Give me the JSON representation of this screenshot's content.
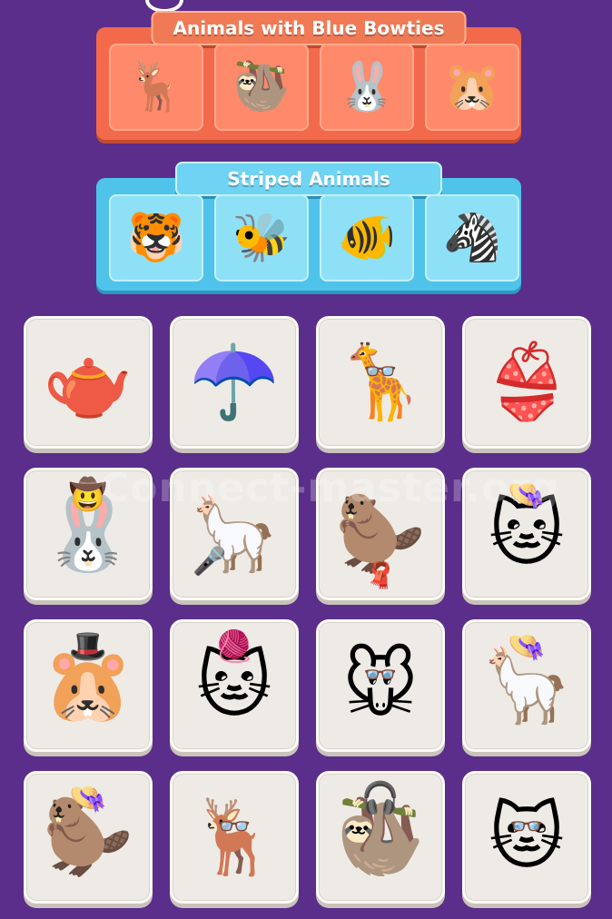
{
  "groups": [
    {
      "title": "Animals with Blue Bowties",
      "slots": [
        {
          "icon": "deer-with-blue-bowtie",
          "glyph": "🦌"
        },
        {
          "icon": "sloth-with-blue-bowtie",
          "glyph": "🦥"
        },
        {
          "icon": "rabbit-with-hat-and-blue-bowtie",
          "glyph": "🐰"
        },
        {
          "icon": "hamster-with-blue-bowtie",
          "glyph": "🐹"
        }
      ]
    },
    {
      "title": "Striped Animals",
      "slots": [
        {
          "icon": "tiger",
          "glyph": "🐯"
        },
        {
          "icon": "bee",
          "glyph": "🐝"
        },
        {
          "icon": "striped-fish",
          "glyph": "🐠"
        },
        {
          "icon": "zebra",
          "glyph": "🦓"
        }
      ]
    }
  ],
  "tiles": [
    {
      "icon": "polka-dot-teapot",
      "glyph": "🫖"
    },
    {
      "icon": "polka-dot-umbrella",
      "glyph": "☂️"
    },
    {
      "icon": "giraffe-with-red-glasses",
      "glyph": "🦒",
      "acc": "👓",
      "acc_pos": "glasses"
    },
    {
      "icon": "polka-dot-bikini",
      "glyph": "👙"
    },
    {
      "icon": "rabbit-with-red-cowboy-hat",
      "glyph": "🐰",
      "acc": "🤠",
      "acc_pos": "hat"
    },
    {
      "icon": "llama-singer-with-microphone",
      "glyph": "🦙",
      "acc": "🎤",
      "acc_pos": "mic"
    },
    {
      "icon": "beaver-with-flower-crown-and-scarf",
      "glyph": "🦫",
      "acc": "🧣",
      "acc_pos": "neck"
    },
    {
      "icon": "cat-with-pink-hat",
      "glyph": "🐱",
      "acc": "👒",
      "acc_pos": "hat"
    },
    {
      "icon": "hamster-with-pink-top-hat",
      "glyph": "🐹",
      "acc": "🎩",
      "acc_pos": "hat"
    },
    {
      "icon": "cat-with-beanie-and-scarf",
      "glyph": "🐱",
      "acc": "🧶",
      "acc_pos": "hat"
    },
    {
      "icon": "mouse-with-red-glasses",
      "glyph": "🐭",
      "acc": "👓",
      "acc_pos": "glasses"
    },
    {
      "icon": "llama-with-pink-hat",
      "glyph": "🦙",
      "acc": "👒",
      "acc_pos": "hat"
    },
    {
      "icon": "meerkat-with-red-hat",
      "glyph": "🦫",
      "acc": "👒",
      "acc_pos": "hat"
    },
    {
      "icon": "deer-with-red-glasses-and-bowtie",
      "glyph": "🦌",
      "acc": "👓",
      "acc_pos": "glasses"
    },
    {
      "icon": "sloth-with-headphones-and-beanie",
      "glyph": "🦥",
      "acc": "🎧",
      "acc_pos": "hat"
    },
    {
      "icon": "cat-with-red-glasses",
      "glyph": "🐱",
      "acc": "👓",
      "acc_pos": "glasses"
    }
  ],
  "watermark": "Connect-master.org",
  "colors": {
    "background": "#5a2e8a",
    "orange_group": "#f26a4b",
    "blue_group": "#4fc3ea",
    "tile": "#eeebe6"
  }
}
